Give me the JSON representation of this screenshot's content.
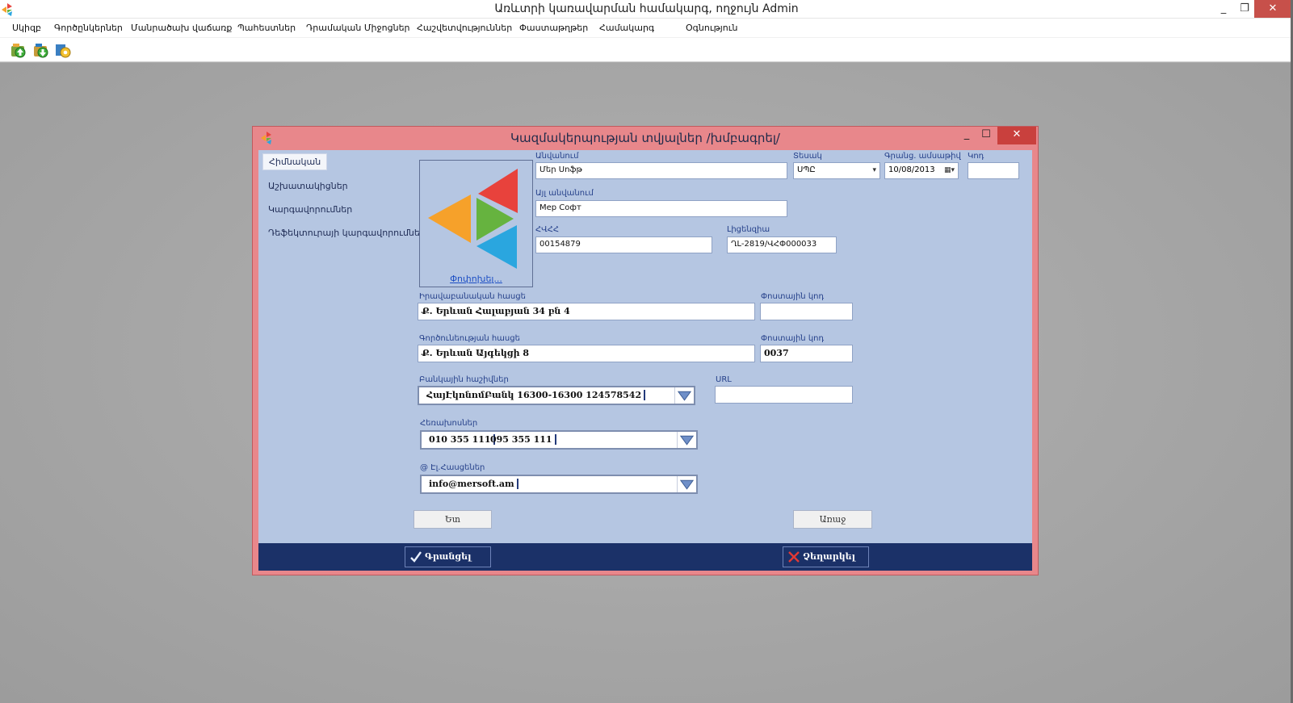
{
  "window": {
    "title": "Առևտրի կառավարման համակարգ, ողջույն Admin",
    "min": "_",
    "restore": "❐",
    "close": "✕"
  },
  "menu": [
    "Սկիզբ",
    "Գործընկերներ",
    "Մանրածախ վաճառք",
    "Պահեստներ",
    "Դրամական Միջոցներ",
    "Հաշվետվություններ",
    "Փաստաթղթեր",
    "Համակարգ",
    "Օգնություն"
  ],
  "dialog": {
    "title": "Կազմակերպության տվյալներ /խմբագրել/",
    "min": "_",
    "max": "☐",
    "close": "✕"
  },
  "nav": [
    "Հիմնական",
    "Աշխատակիցներ",
    "Կարգավորումներ",
    "Դեֆեկտուրայի կարգավորումներ"
  ],
  "logo_link": "Փոփոխել...",
  "form": {
    "name_label": "Անվանում",
    "name_value": "Մեր Սոֆթ",
    "status_label": "Տեսակ",
    "status_value": "ՍՊԸ",
    "regdate_label": "Գրանց. ամսաթիվ",
    "regdate_value": "10/08/2013",
    "code_label": "Կոդ",
    "code_value": "",
    "othername_label": "Այլ անվանում",
    "othername_value": "Мер Софт",
    "tin_label": "ՀՎՀՀ",
    "tin_value": "00154879",
    "license_label": "Լիցենզիա",
    "license_value": "ՂԼ-2819/ՎՀՓ000033",
    "legaladdr_label": "Իրավաբանական հասցե",
    "legaladdr_value": "Ք. Երևան Հալաբյան 34 բն 4",
    "postal1_label": "Փոստային կոդ",
    "postal1_value": "",
    "actaddr_label": "Գործունեության հասցե",
    "actaddr_value": "Ք. Երևան Այգեկցի 8",
    "postal2_label": "Փոստային կոդ",
    "postal2_value": "0037",
    "bank_label": "Բանկային հաշիվներ",
    "bank_value": "ՀայԷկոնոմԲանկ  16300-16300 124578542",
    "url_label": "URL",
    "url_value": "",
    "phones_label": "Հեռախոսներ",
    "phone1": "010 355 111",
    "phone2": "095 355 111",
    "email_label": "@ Էլ.Հասցեներ",
    "email1": "info@mersoft.am"
  },
  "buttons": {
    "back": "Ետ",
    "next": "Առաջ",
    "save": "Գրանցել",
    "cancel": "Չեղարկել"
  },
  "colors": {
    "dialog_frame": "#e8878b",
    "dialog_body": "#b5c6e2",
    "footer": "#1b3168",
    "logo_red": "#e8423c",
    "logo_orange": "#f6a12a",
    "logo_green": "#66b33f",
    "logo_blue": "#2aa6df"
  }
}
